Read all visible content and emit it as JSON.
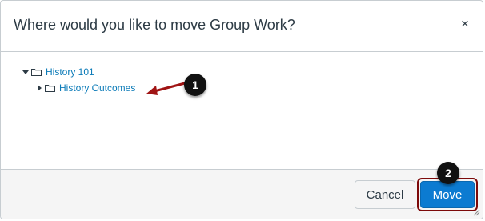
{
  "dialog": {
    "title": "Where would you like to move Group Work?",
    "close_glyph": "×"
  },
  "tree": {
    "items": [
      {
        "label": "History 101",
        "expanded": true,
        "icon": "folder-icon"
      },
      {
        "label": "History Outcomes",
        "expanded": false,
        "icon": "folder-icon"
      }
    ]
  },
  "callouts": {
    "first": "1",
    "second": "2"
  },
  "footer": {
    "cancel_label": "Cancel",
    "move_label": "Move"
  },
  "colors": {
    "link": "#0c7bb8",
    "primary": "#0c7bd1",
    "highlight": "#7d0a0a"
  }
}
